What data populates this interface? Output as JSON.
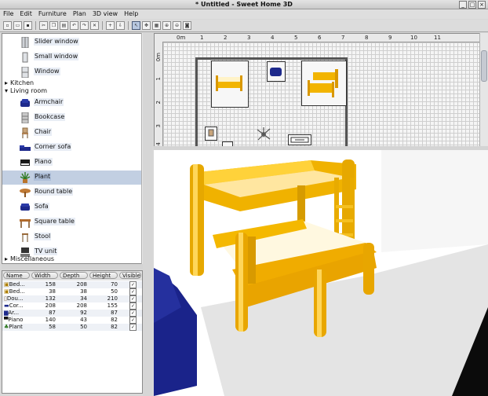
{
  "window": {
    "title": "* Untitled - Sweet Home 3D"
  },
  "menu": [
    "File",
    "Edit",
    "Furniture",
    "Plan",
    "3D view",
    "Help"
  ],
  "toolbar_icons": [
    "new-icon",
    "open-icon",
    "save-icon",
    "cut-icon",
    "copy-icon",
    "paste-icon",
    "undo-icon",
    "redo-icon",
    "delete-icon",
    "add-furniture-icon",
    "import-icon",
    "select-icon",
    "pan-icon",
    "create-walls-icon",
    "zoom-in-icon",
    "zoom-out-icon",
    "create-photo-icon"
  ],
  "catalog": {
    "items_top": [
      {
        "label": "Slider window",
        "icon": "window-icon"
      },
      {
        "label": "Small window",
        "icon": "window-icon"
      },
      {
        "label": "Window",
        "icon": "window-icon"
      }
    ],
    "categories": {
      "kitchen": "Kitchen",
      "living_room": "Living room",
      "misc": "Miscellaneous"
    },
    "living_room_items": [
      {
        "label": "Armchair",
        "icon": "armchair-icon"
      },
      {
        "label": "Bookcase",
        "icon": "bookcase-icon"
      },
      {
        "label": "Chair",
        "icon": "chair-icon"
      },
      {
        "label": "Corner sofa",
        "icon": "corner-sofa-icon"
      },
      {
        "label": "Piano",
        "icon": "piano-icon"
      },
      {
        "label": "Plant",
        "icon": "plant-icon",
        "selected": true
      },
      {
        "label": "Round table",
        "icon": "round-table-icon"
      },
      {
        "label": "Sofa",
        "icon": "sofa-icon"
      },
      {
        "label": "Square table",
        "icon": "square-table-icon"
      },
      {
        "label": "Stool",
        "icon": "stool-icon"
      },
      {
        "label": "TV unit",
        "icon": "tv-unit-icon"
      }
    ]
  },
  "furniture_table": {
    "headers": [
      "Name",
      "Width",
      "Depth",
      "Height",
      "Visible"
    ],
    "rows": [
      {
        "name": "Bed...",
        "width": "158",
        "depth": "208",
        "height": "70",
        "visible": true
      },
      {
        "name": "Bed...",
        "width": "38",
        "depth": "38",
        "height": "50",
        "visible": true
      },
      {
        "name": "Dou...",
        "width": "132",
        "depth": "34",
        "height": "210",
        "visible": true
      },
      {
        "name": "Cor...",
        "width": "208",
        "depth": "208",
        "height": "155",
        "visible": true
      },
      {
        "name": "Ar...",
        "width": "87",
        "depth": "92",
        "height": "87",
        "visible": true
      },
      {
        "name": "Piano",
        "width": "140",
        "depth": "43",
        "height": "82",
        "visible": true
      },
      {
        "name": "Plant",
        "width": "58",
        "depth": "50",
        "height": "82",
        "visible": true
      }
    ]
  },
  "plan": {
    "ruler_x": [
      "0m",
      "1",
      "2",
      "3",
      "4",
      "5",
      "6",
      "7",
      "8",
      "9",
      "10",
      "11"
    ],
    "ruler_y": [
      "0m",
      "1",
      "2",
      "3",
      "4"
    ]
  },
  "colors": {
    "furniture_yellow": "#f2b400",
    "sofa_blue": "#1e2a8c",
    "selection": "#c2cfe2"
  }
}
